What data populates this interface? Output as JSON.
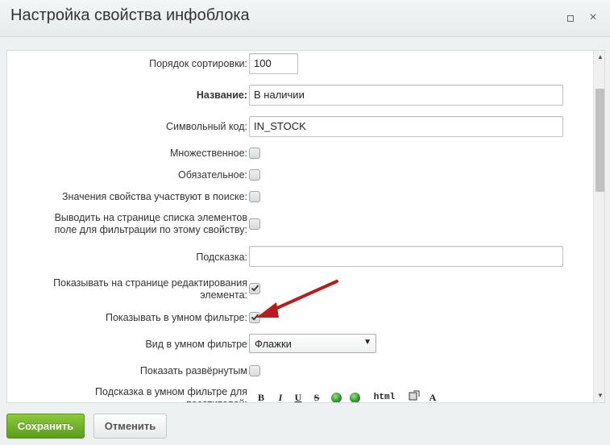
{
  "dialog": {
    "title": "Настройка свойства инфоблока",
    "maximize_icon": "maximize-icon",
    "close_icon": "close-icon",
    "close_glyph": "×"
  },
  "form": {
    "sort": {
      "label": "Порядок сортировки:",
      "value": "100"
    },
    "name": {
      "label": "Название:",
      "value": "В наличии"
    },
    "code": {
      "label": "Символьный код:",
      "value": "IN_STOCK"
    },
    "multiple": {
      "label": "Множественное:",
      "checked": false
    },
    "required": {
      "label": "Обязательное:",
      "checked": false
    },
    "searchable": {
      "label": "Значения свойства участвуют в поиске:",
      "checked": false
    },
    "filtrable": {
      "label": "Выводить на странице списка элементов поле для фильтрации по этому свойству:",
      "checked": false
    },
    "hint": {
      "label": "Подсказка:",
      "value": ""
    },
    "show_edit": {
      "label": "Показывать на странице редактирования элемента:",
      "checked": true
    },
    "smart_filter": {
      "label": "Показывать в умном фильтре:",
      "checked": true
    },
    "smart_filter_view": {
      "label": "Вид в умном фильтре",
      "selected": "Флажки"
    },
    "show_expanded": {
      "label": "Показать развёрнутым",
      "checked": false
    },
    "smart_filter_hint": {
      "label": "Подсказка в умном фильтре для посетителей:"
    }
  },
  "editor_toolbar": {
    "bold": "B",
    "italic": "I",
    "underline": "U",
    "strike": "S",
    "html": "html",
    "spell": "A"
  },
  "footer": {
    "save_label": "Сохранить",
    "cancel_label": "Отменить"
  },
  "colors": {
    "save_button": "#6aae22",
    "annotation_arrow": "#b81d1d"
  }
}
